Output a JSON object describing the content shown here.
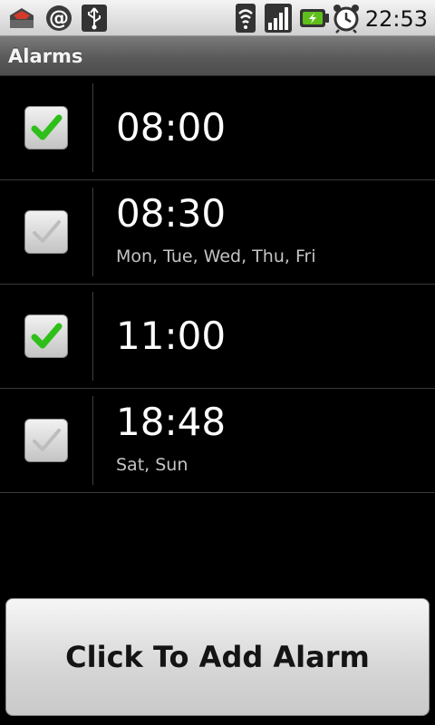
{
  "status_bar": {
    "time": "22:53",
    "icons": [
      "inbox-icon",
      "at-sign-icon",
      "usb-icon",
      "wifi-icon",
      "signal-icon",
      "battery-charging-icon",
      "alarm-clock-icon"
    ],
    "colors": {
      "battery": "#5fbf1a"
    }
  },
  "title_bar": {
    "title": "Alarms"
  },
  "alarms": [
    {
      "time": "08:00",
      "days": "",
      "enabled": true
    },
    {
      "time": "08:30",
      "days": "Mon, Tue, Wed, Thu, Fri",
      "enabled": false
    },
    {
      "time": "11:00",
      "days": "",
      "enabled": true
    },
    {
      "time": "18:48",
      "days": "Sat, Sun",
      "enabled": false
    }
  ],
  "add_button": {
    "label": "Click To Add Alarm"
  },
  "colors": {
    "check_on": "#2fbf1a",
    "check_off": "#bdbdbd"
  }
}
